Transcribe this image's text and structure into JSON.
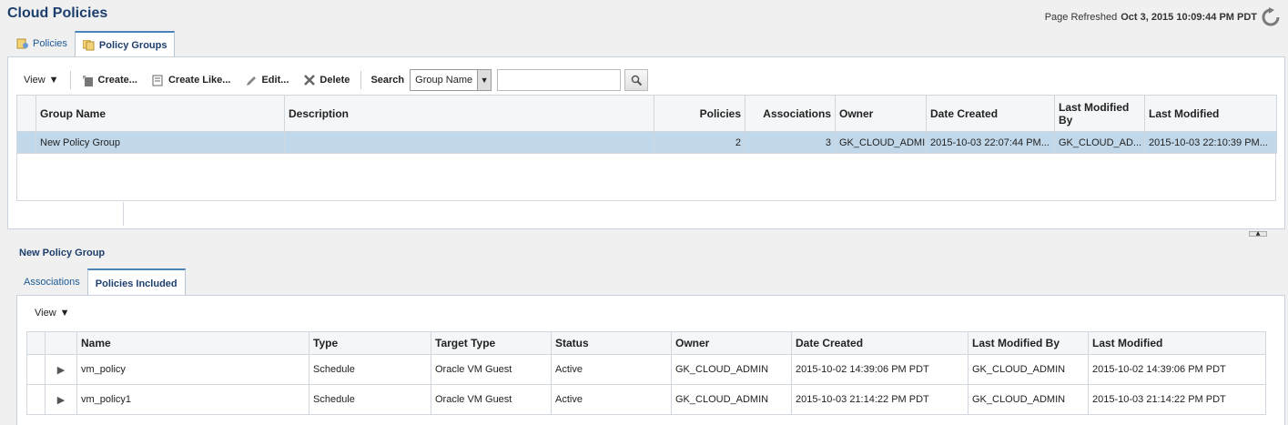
{
  "header": {
    "title": "Cloud Policies",
    "refreshed_label": "Page Refreshed",
    "refreshed_value": "Oct 3, 2015 10:09:44 PM PDT"
  },
  "top_tabs": [
    {
      "label": "Policies",
      "icon": "policy-icon"
    },
    {
      "label": "Policy Groups",
      "icon": "policy-group-icon",
      "active": true
    }
  ],
  "toolbar": {
    "view": "View",
    "create": "Create...",
    "create_like": "Create Like...",
    "edit": "Edit...",
    "delete": "Delete",
    "search_label": "Search",
    "search_field": "Group Name",
    "search_value": ""
  },
  "groups_table": {
    "columns": [
      "Group Name",
      "Description",
      "Policies",
      "Associations",
      "Owner",
      "Date Created",
      "Last Modified By",
      "Last Modified"
    ],
    "rows": [
      {
        "group_name": "New Policy Group",
        "description": "",
        "policies": "2",
        "associations": "3",
        "owner": "GK_CLOUD_ADMIN",
        "date_created": "2015-10-03 22:07:44 PM...",
        "last_modified_by": "GK_CLOUD_AD...",
        "last_modified": "2015-10-03 22:10:39 PM..."
      }
    ]
  },
  "detail": {
    "title": "New Policy Group",
    "tabs": [
      {
        "label": "Associations"
      },
      {
        "label": "Policies Included",
        "active": true
      }
    ],
    "view": "View",
    "columns": [
      "Name",
      "Type",
      "Target Type",
      "Status",
      "Owner",
      "Date Created",
      "Last Modified By",
      "Last Modified"
    ],
    "rows": [
      {
        "name": "vm_policy",
        "type": "Schedule",
        "target_type": "Oracle VM Guest",
        "status": "Active",
        "owner": "GK_CLOUD_ADMIN",
        "date_created": "2015-10-02 14:39:06 PM PDT",
        "last_modified_by": "GK_CLOUD_ADMIN",
        "last_modified": "2015-10-02 14:39:06 PM PDT"
      },
      {
        "name": "vm_policy1",
        "type": "Schedule",
        "target_type": "Oracle VM Guest",
        "status": "Active",
        "owner": "GK_CLOUD_ADMIN",
        "date_created": "2015-10-03 21:14:22 PM PDT",
        "last_modified_by": "GK_CLOUD_ADMIN",
        "last_modified": "2015-10-03 21:14:22 PM PDT"
      }
    ]
  }
}
